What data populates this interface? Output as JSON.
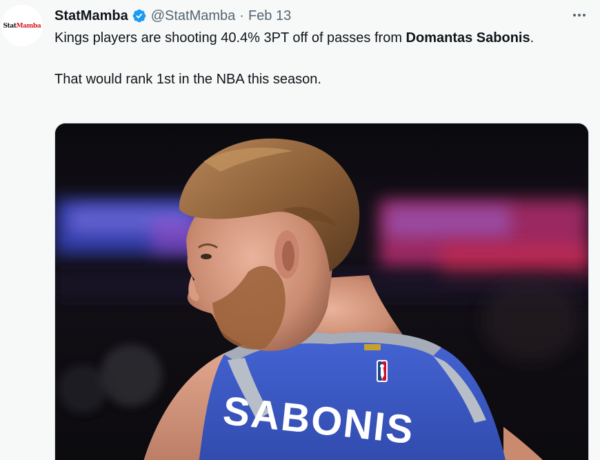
{
  "tweet": {
    "author": {
      "display_name": "StatMamba",
      "handle": "@StatMamba",
      "verified": true,
      "avatar": {
        "logo_part1": "Stat",
        "logo_part2": "Mamba",
        "logo_color1": "#111111",
        "logo_color2": "#d71920"
      }
    },
    "separator": "·",
    "date": "Feb 13",
    "text": {
      "line1_before": "Kings players are shooting 40.4% 3PT off of passes from ",
      "line1_bold": "Domantas Sabonis",
      "line1_after": ".",
      "line2": "That would rank 1st in the NBA this season."
    },
    "media": {
      "jersey_text": "SABONIS",
      "jersey_color": "#3a5bc4"
    },
    "more_icon": "more-horizontal-icon"
  },
  "colors": {
    "verified_blue": "#1d9bf0",
    "secondary_text": "#536471",
    "background": "#f7f9f9"
  }
}
